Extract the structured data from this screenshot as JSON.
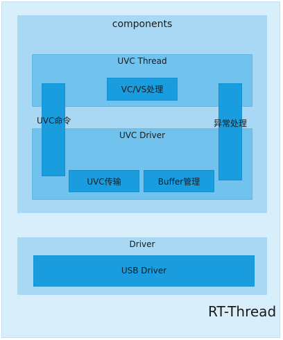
{
  "diagram": {
    "components_title": "components",
    "uvc_thread_title": "UVC Thread",
    "vcvs_label": "VC/VS处理",
    "uvc_cmd_label": "UVC命令",
    "exception_label": "异常处理",
    "uvc_driver_title": "UVC Driver",
    "uvc_transfer_label": "UVC传输",
    "buffer_label": "Buffer管理",
    "driver_title": "Driver",
    "usb_driver_label": "USB Driver",
    "rtthread_label": "RT-Thread"
  },
  "colors": {
    "outer": "#d8eefa",
    "layer": "#a8d8f4",
    "module": "#72c2ee",
    "block": "#1a9ddf"
  }
}
